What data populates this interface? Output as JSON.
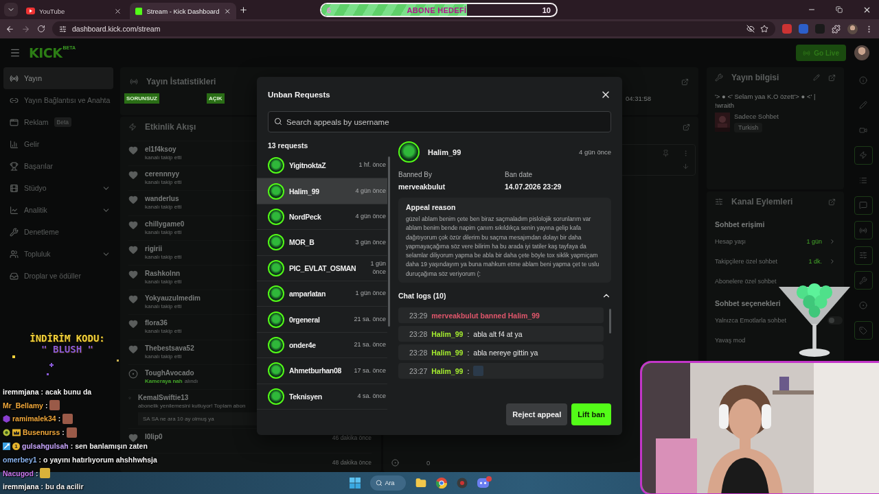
{
  "browser": {
    "tabs": [
      {
        "title": "YouTube",
        "selected": false
      },
      {
        "title": "Stream - Kick Dashboard",
        "selected": true
      }
    ],
    "url": "dashboard.kick.com/stream"
  },
  "header": {
    "logo": "KICK",
    "logo_badge": "BETA",
    "go_live": "Go Live"
  },
  "sidebar": {
    "items": [
      {
        "label": "Yayın",
        "selected": true,
        "expandable": false
      },
      {
        "label": "Yayın Bağlantısı ve Anahta",
        "selected": false,
        "expandable": false
      },
      {
        "label": "Reklam",
        "badge": "Beta",
        "selected": false,
        "expandable": false
      },
      {
        "label": "Gelir",
        "selected": false,
        "expandable": false
      },
      {
        "label": "Başarılar",
        "selected": false,
        "expandable": false
      },
      {
        "label": "Stüdyo",
        "selected": false,
        "expandable": true
      },
      {
        "label": "Analitik",
        "selected": false,
        "expandable": true
      },
      {
        "label": "Denetleme",
        "selected": false,
        "expandable": false
      },
      {
        "label": "Topluluk",
        "selected": false,
        "expandable": true
      },
      {
        "label": "Droplar ve ödüller",
        "selected": false,
        "expandable": false
      }
    ]
  },
  "stats": {
    "title": "Yayın İstatistikleri",
    "badges": [
      "SORUNSUZ",
      "AÇIK"
    ],
    "uptime": "04:31:58"
  },
  "events": {
    "title": "Etkinlik Akışı",
    "items": [
      {
        "kind": "follow",
        "name": "el1f4ksoy",
        "action": "kanalı takip etti"
      },
      {
        "kind": "follow",
        "name": "cerennnyy",
        "action": "kanalı takip etti"
      },
      {
        "kind": "follow",
        "name": "wanderlus",
        "action": "kanalı takip etti"
      },
      {
        "kind": "follow",
        "name": "chillygame0",
        "action": "kanalı takip etti"
      },
      {
        "kind": "follow",
        "name": "rigirii",
        "action": "kanalı takip etti"
      },
      {
        "kind": "follow",
        "name": "Rashkolnn",
        "action": "kanalı takip etti"
      },
      {
        "kind": "follow",
        "name": "Yokyauzulmedim",
        "action": "kanalı takip etti"
      },
      {
        "kind": "follow",
        "name": "flora36",
        "action": "kanalı takip etti"
      },
      {
        "kind": "follow",
        "name": "Thebestsava52",
        "action": "kanalı takip etti"
      },
      {
        "kind": "reward",
        "name": "ToughAvocado",
        "reward": "Kameraya nah",
        "action": "alındı"
      },
      {
        "kind": "sub",
        "name": "KemalSwiftie13",
        "action": "abonelik yenilemesini kutluyor! Toplam abon",
        "message": "SA SA ne ara 10 ay olmuş ya"
      },
      {
        "kind": "follow",
        "name": "l0lip0",
        "time": "46 dakika önce"
      },
      {
        "kind": "hidden",
        "time": "48 dakika önce"
      }
    ]
  },
  "chat_panel": {
    "count": "0"
  },
  "stream_info": {
    "title": "Yayın bilgisi",
    "stream_title": "'> ● <' Selam yaa K.O özett'> ● <' | !wraith",
    "category": "Sadece Sohbet",
    "language": "Turkish"
  },
  "channel_actions": {
    "title": "Kanal Eylemleri",
    "sections": [
      {
        "title": "Sohbet erişimi",
        "rows": [
          {
            "kind": "link",
            "label": "Hesap yaşı",
            "value": "1 gün"
          },
          {
            "kind": "link",
            "label": "Takipçilere özel sohbet",
            "value": "1 dk."
          },
          {
            "kind": "plain",
            "label": "Abonelere özel sohbet"
          }
        ]
      },
      {
        "title": "Sohbet seçenekleri",
        "rows": [
          {
            "kind": "toggle",
            "label": "Yalnızca Emotlarla sohbet",
            "on": false
          },
          {
            "kind": "plain",
            "label": "Yavaş mod"
          }
        ]
      }
    ]
  },
  "rail": [
    {
      "active": false
    },
    {
      "active": false
    },
    {
      "active": false
    },
    {
      "active": true
    },
    {
      "active": false
    },
    {
      "active": true
    },
    {
      "active": true
    },
    {
      "active": true
    },
    {
      "active": true
    },
    {
      "active": false
    },
    {
      "active": true
    }
  ],
  "modal": {
    "title": "Unban Requests",
    "search_placeholder": "Search appeals by username",
    "count": "13 requests",
    "requests": [
      {
        "name": "YigitnoktaZ",
        "time": "1 hf. önce",
        "selected": false
      },
      {
        "name": "Halim_99",
        "time": "4 gün önce",
        "selected": true
      },
      {
        "name": "NordPeck",
        "time": "4 gün önce",
        "selected": false
      },
      {
        "name": "MOR_B",
        "time": "3 gün önce",
        "selected": false
      },
      {
        "name": "PIC_EVLAT_OSMAN",
        "time": "1 gün önce",
        "selected": false
      },
      {
        "name": "amparlatan",
        "time": "1 gün önce",
        "selected": false
      },
      {
        "name": "0rgeneral",
        "time": "21 sa. önce",
        "selected": false
      },
      {
        "name": "onder4e",
        "time": "21 sa. önce",
        "selected": false
      },
      {
        "name": "Ahmetburhan08",
        "time": "17 sa. önce",
        "selected": false
      },
      {
        "name": "Teknisyen",
        "time": "4 sa. önce",
        "selected": false
      }
    ],
    "detail": {
      "name": "Halim_99",
      "time": "4 gün önce",
      "banned_by_label": "Banned By",
      "banned_by": "merveakbulut",
      "ban_date_label": "Ban date",
      "ban_date": "14.07.2026 23:29",
      "reason_title": "Appeal reason",
      "reason": "güzel ablam benim çete ben biraz saçmaladım pislolojik sorunlarım var ablam benim bende napim çanım sıkıldıkça senin yayına gelip kafa dağıtıyorum çok özür dilerim bu saçma mesajımdan dolayı bir daha yapmayaçağıma söz vere bilirim ha bu arada iyi tatiler kaş tayfaya da selamlar diliyorum yapma be abla bir daha çete böyle tox siklik yapmiçam daha 19 yaşındayım ya buna mahkum etme ablam beni yapma çet te uslu duruçağıma söz veriyorum (:",
      "logs_title": "Chat logs (10)",
      "logs_expanded": true,
      "logs": [
        {
          "kind": "ban",
          "time": "23:29",
          "text": "merveakbulut banned Halim_99"
        },
        {
          "kind": "message",
          "time": "23:28",
          "user": "Halim_99",
          "separator": ":",
          "text": "abla alt f4 at ya"
        },
        {
          "kind": "message",
          "time": "23:28",
          "user": "Halim_99",
          "separator": ":",
          "text": "abla nereye gittin ya"
        },
        {
          "kind": "emote",
          "time": "23:27",
          "user": "Halim_99",
          "separator": ":"
        }
      ]
    },
    "reject": "Reject appeal",
    "lift": "Lift ban"
  },
  "overlay": {
    "goal": {
      "current": "6",
      "label": "ABONE HEDEFİ",
      "target": "10",
      "level": 0.62
    },
    "promo": {
      "line1": "İNDİRİM KODU:",
      "line2": "\" BLUSH \""
    },
    "chat": [
      {
        "kind": "text",
        "user": "iremmjana",
        "color": "#ffffff",
        "separator": ":",
        "message": "acak bunu da"
      },
      {
        "kind": "emote",
        "user": "Mr_Bellamy",
        "color": "#f2a93b",
        "separator": ":"
      },
      {
        "kind": "emote",
        "user": "ramimalek34",
        "color": "#f2a93b",
        "separator": ":",
        "badges": [
          {
            "kind": "gem"
          }
        ]
      },
      {
        "kind": "emote",
        "user": "Busenurss",
        "color": "#f2a93b",
        "separator": ":",
        "badges": [
          {
            "kind": "clover"
          },
          {
            "kind": "crown"
          }
        ]
      },
      {
        "kind": "text",
        "user": "gulsahgulsah",
        "color": "#c9a7ff",
        "separator": ":",
        "badges": [
          {
            "kind": "sword"
          },
          {
            "kind": "count",
            "label": "1"
          }
        ],
        "message": "sen banlamışın zaten"
      },
      {
        "kind": "text",
        "user": "omerbey1",
        "color": "#8ab4f0",
        "separator": ":",
        "message": "o yayını hatırlıyorum ahshhwhsja"
      },
      {
        "kind": "emote",
        "user": "Nacugod",
        "color": "#cc77ee",
        "separator": ":"
      },
      {
        "kind": "text",
        "user": "iremmjana",
        "color": "#ffffff",
        "separator": ":",
        "message": "bu da acilir"
      }
    ]
  },
  "taskbar": {
    "search": "Ara"
  }
}
